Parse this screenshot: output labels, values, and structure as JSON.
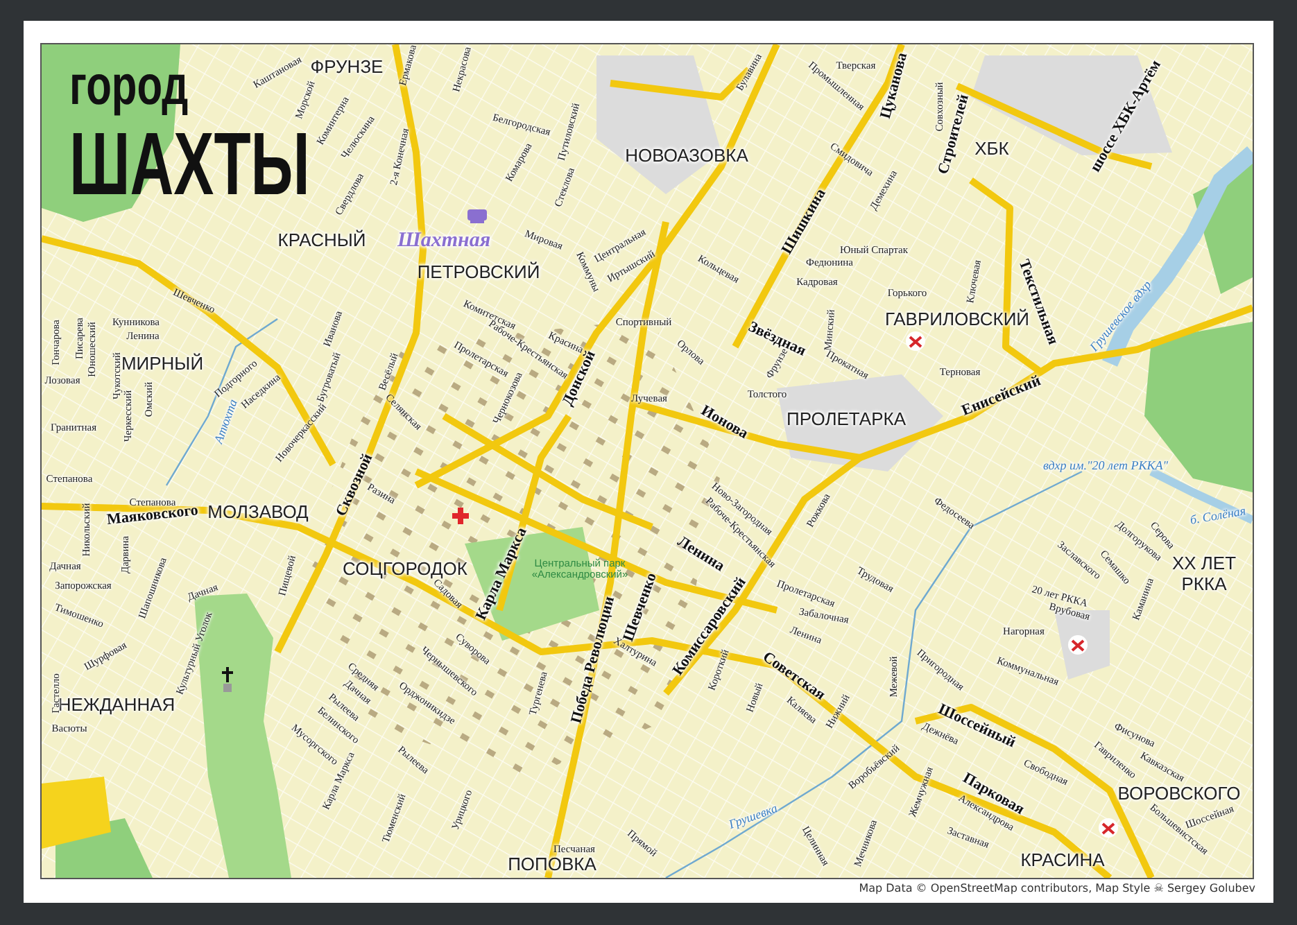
{
  "title": {
    "line_1": "город",
    "line_2": "ШАХТЫ"
  },
  "labels": [
    {
      "kind": "district",
      "text": "ФРУНЗЕ"
    },
    {
      "kind": "district",
      "text": "НОВОАЗОВКА"
    },
    {
      "kind": "district",
      "text": "КРАСНЫЙ"
    },
    {
      "kind": "district",
      "text": "ПЕТРОВСКИЙ"
    },
    {
      "kind": "district",
      "text": "ХБК"
    },
    {
      "kind": "district",
      "text": "ГАВРИЛОВСКИЙ"
    },
    {
      "kind": "district",
      "text": "МИРНЫЙ"
    },
    {
      "kind": "district",
      "text": "ПРОЛЕТАРКА"
    },
    {
      "kind": "district",
      "text": "МОЛЗАВОД"
    },
    {
      "kind": "district",
      "text": "СОЦГОРОДОК"
    },
    {
      "kind": "district",
      "text": "XX ЛЕТ"
    },
    {
      "kind": "district",
      "text": "РККА"
    },
    {
      "kind": "district",
      "text": "НЕЖДАННАЯ"
    },
    {
      "kind": "district",
      "text": "ВОРОВСКОГО"
    },
    {
      "kind": "district",
      "text": "ПОПОВКА"
    },
    {
      "kind": "district",
      "text": "КРАСИНА"
    },
    {
      "kind": "station",
      "text": "Шахтная"
    },
    {
      "kind": "park",
      "text": "Центральный парк «Александровский»"
    },
    {
      "kind": "major_street",
      "text": "Донской"
    },
    {
      "kind": "major_street",
      "text": "Ионова"
    },
    {
      "kind": "major_street",
      "text": "Карла Маркса"
    },
    {
      "kind": "major_street",
      "text": "Победа Революции"
    },
    {
      "kind": "major_street",
      "text": "Комиссаровский"
    },
    {
      "kind": "major_street",
      "text": "Советская"
    },
    {
      "kind": "major_street",
      "text": "Шоссейный"
    },
    {
      "kind": "major_street",
      "text": "Парковая"
    },
    {
      "kind": "major_street",
      "text": "Енисейский"
    },
    {
      "kind": "major_street",
      "text": "Сквозной"
    },
    {
      "kind": "major_street",
      "text": "Маяковского"
    },
    {
      "kind": "major_street",
      "text": "Ленина"
    },
    {
      "kind": "major_street",
      "text": "Шевченко"
    },
    {
      "kind": "major_street",
      "text": "Звёздная"
    },
    {
      "kind": "major_street",
      "text": "Шишкина"
    },
    {
      "kind": "major_street",
      "text": "Цуканова"
    },
    {
      "kind": "major_street",
      "text": "Строителей"
    },
    {
      "kind": "major_street",
      "text": "шоссе ХБК-Артём"
    },
    {
      "kind": "major_street",
      "text": "Текстильная"
    },
    {
      "kind": "street",
      "text": "Каштановая"
    },
    {
      "kind": "street",
      "text": "Морской"
    },
    {
      "kind": "street",
      "text": "Коминтерна"
    },
    {
      "kind": "street",
      "text": "Челюскина"
    },
    {
      "kind": "street",
      "text": "Свердлова"
    },
    {
      "kind": "street",
      "text": "2-я Конечная"
    },
    {
      "kind": "street",
      "text": "Ермакова"
    },
    {
      "kind": "street",
      "text": "Некрасова"
    },
    {
      "kind": "street",
      "text": "Белгородская"
    },
    {
      "kind": "street",
      "text": "Путиловский"
    },
    {
      "kind": "street",
      "text": "Комарова"
    },
    {
      "kind": "street",
      "text": "Стеклова"
    },
    {
      "kind": "street",
      "text": "Мировая"
    },
    {
      "kind": "street",
      "text": "Коммуны"
    },
    {
      "kind": "street",
      "text": "Центральная"
    },
    {
      "kind": "street",
      "text": "Иртышский"
    },
    {
      "kind": "street",
      "text": "Шевченко"
    },
    {
      "kind": "street",
      "text": "Кунникова"
    },
    {
      "kind": "street",
      "text": "Ленина"
    },
    {
      "kind": "street",
      "text": "Гончарова"
    },
    {
      "kind": "street",
      "text": "Писарева"
    },
    {
      "kind": "street",
      "text": "Юношеский"
    },
    {
      "kind": "street",
      "text": "Лозовая"
    },
    {
      "kind": "street",
      "text": "Чукотский"
    },
    {
      "kind": "street",
      "text": "Черкесский"
    },
    {
      "kind": "street",
      "text": "Омский"
    },
    {
      "kind": "street",
      "text": "Гранитная"
    },
    {
      "kind": "street",
      "text": "Подгорного"
    },
    {
      "kind": "street",
      "text": "Наседкина"
    },
    {
      "kind": "street",
      "text": "Бугроватый"
    },
    {
      "kind": "street",
      "text": "Новочеркасский"
    },
    {
      "kind": "street",
      "text": "Иванова"
    },
    {
      "kind": "street",
      "text": "Весёлый"
    },
    {
      "kind": "street",
      "text": "Селянская"
    },
    {
      "kind": "street",
      "text": "Комитетская"
    },
    {
      "kind": "street",
      "text": "Рабоче-Крестьянская"
    },
    {
      "kind": "street",
      "text": "Пролетарская"
    },
    {
      "kind": "street",
      "text": "Красина"
    },
    {
      "kind": "street",
      "text": "Чернокозова"
    },
    {
      "kind": "street",
      "text": "Спортивный"
    },
    {
      "kind": "street",
      "text": "Лучевая"
    },
    {
      "kind": "street",
      "text": "Тверская"
    },
    {
      "kind": "street",
      "text": "Булавина"
    },
    {
      "kind": "street",
      "text": "Промышленная"
    },
    {
      "kind": "street",
      "text": "Совхозный"
    },
    {
      "kind": "street",
      "text": "Смидовича"
    },
    {
      "kind": "street",
      "text": "Юный Спартак"
    },
    {
      "kind": "street",
      "text": "Федюнина"
    },
    {
      "kind": "street",
      "text": "Кадровая"
    },
    {
      "kind": "street",
      "text": "Горького"
    },
    {
      "kind": "street",
      "text": "Минский"
    },
    {
      "kind": "street",
      "text": "Прокатная"
    },
    {
      "kind": "street",
      "text": "Терновая"
    },
    {
      "kind": "street",
      "text": "Ключевая"
    },
    {
      "kind": "street",
      "text": "Толстого"
    },
    {
      "kind": "street",
      "text": "Фрунзе"
    },
    {
      "kind": "street",
      "text": "Орлова"
    },
    {
      "kind": "street",
      "text": "Кольцевая"
    },
    {
      "kind": "street",
      "text": "Демехина"
    },
    {
      "kind": "street",
      "text": "Степанова"
    },
    {
      "kind": "street",
      "text": "Степанова"
    },
    {
      "kind": "street",
      "text": "Никольский"
    },
    {
      "kind": "street",
      "text": "Дарвина"
    },
    {
      "kind": "street",
      "text": "Дачная"
    },
    {
      "kind": "street",
      "text": "Запорожская"
    },
    {
      "kind": "street",
      "text": "Шапошникова"
    },
    {
      "kind": "street",
      "text": "Тимошенко"
    },
    {
      "kind": "street",
      "text": "Дачная"
    },
    {
      "kind": "street",
      "text": "Культурный Уголок"
    },
    {
      "kind": "street",
      "text": "Шурфовая"
    },
    {
      "kind": "street",
      "text": "Гастелло"
    },
    {
      "kind": "street",
      "text": "Васюты"
    },
    {
      "kind": "street",
      "text": "Пищевой"
    },
    {
      "kind": "street",
      "text": "Садовая"
    },
    {
      "kind": "street",
      "text": "Суворова"
    },
    {
      "kind": "street",
      "text": "Чернышевского"
    },
    {
      "kind": "street",
      "text": "Орджоникидзе"
    },
    {
      "kind": "street",
      "text": "Средняя"
    },
    {
      "kind": "street",
      "text": "Дачная"
    },
    {
      "kind": "street",
      "text": "Рылеева"
    },
    {
      "kind": "street",
      "text": "Белинского"
    },
    {
      "kind": "street",
      "text": "Мусоргского"
    },
    {
      "kind": "street",
      "text": "Карла Маркса"
    },
    {
      "kind": "street",
      "text": "Рылеева"
    },
    {
      "kind": "street",
      "text": "Тургенева"
    },
    {
      "kind": "street",
      "text": "Тюменский"
    },
    {
      "kind": "street",
      "text": "Урицкого"
    },
    {
      "kind": "street",
      "text": "Песчаная"
    },
    {
      "kind": "street",
      "text": "Прямой"
    },
    {
      "kind": "street",
      "text": "Халтурина"
    },
    {
      "kind": "street",
      "text": "Разина"
    },
    {
      "kind": "street",
      "text": "Ново-Загородная"
    },
    {
      "kind": "street",
      "text": "Рабоче-Крестьянская"
    },
    {
      "kind": "street",
      "text": "Рожкова"
    },
    {
      "kind": "street",
      "text": "Федосеева"
    },
    {
      "kind": "street",
      "text": "Трудовая"
    },
    {
      "kind": "street",
      "text": "Пролетарская"
    },
    {
      "kind": "street",
      "text": "Забалочная"
    },
    {
      "kind": "street",
      "text": "Ленина"
    },
    {
      "kind": "street",
      "text": "Межевой"
    },
    {
      "kind": "street",
      "text": "Пригородная"
    },
    {
      "kind": "street",
      "text": "Коммунальная"
    },
    {
      "kind": "street",
      "text": "Нагорная"
    },
    {
      "kind": "street",
      "text": "Врубовая"
    },
    {
      "kind": "street",
      "text": "20 лет РККА"
    },
    {
      "kind": "street",
      "text": "Заславского"
    },
    {
      "kind": "street",
      "text": "Семашко"
    },
    {
      "kind": "street",
      "text": "Долгорукова"
    },
    {
      "kind": "street",
      "text": "Серова"
    },
    {
      "kind": "street",
      "text": "Каманина"
    },
    {
      "kind": "street",
      "text": "Дежнёва"
    },
    {
      "kind": "street",
      "text": "Свободная"
    },
    {
      "kind": "street",
      "text": "Фисунова"
    },
    {
      "kind": "street",
      "text": "Гавриленко"
    },
    {
      "kind": "street",
      "text": "Кавказская"
    },
    {
      "kind": "street",
      "text": "Шоссейная"
    },
    {
      "kind": "street",
      "text": "Большевистская"
    },
    {
      "kind": "street",
      "text": "Воробьёвский"
    },
    {
      "kind": "street",
      "text": "Жемчужная"
    },
    {
      "kind": "street",
      "text": "Александрова"
    },
    {
      "kind": "street",
      "text": "Заставная"
    },
    {
      "kind": "street",
      "text": "Целинная"
    },
    {
      "kind": "street",
      "text": "Мечникова"
    },
    {
      "kind": "street",
      "text": "Короткий"
    },
    {
      "kind": "street",
      "text": "Новый"
    },
    {
      "kind": "street",
      "text": "Каляева"
    },
    {
      "kind": "street",
      "text": "Нижний"
    },
    {
      "kind": "water",
      "text": "б. Солёная"
    },
    {
      "kind": "water",
      "text": "Грушевка"
    },
    {
      "kind": "water",
      "text": "Атюхта"
    },
    {
      "kind": "water",
      "text": "Грушевское вдхр"
    },
    {
      "kind": "water",
      "text": "вдхр им.\"20 лет РККА\""
    }
  ],
  "attribution": "Map Data © OpenStreetMap contributors, Map Style ☠ Sergey Golubev"
}
